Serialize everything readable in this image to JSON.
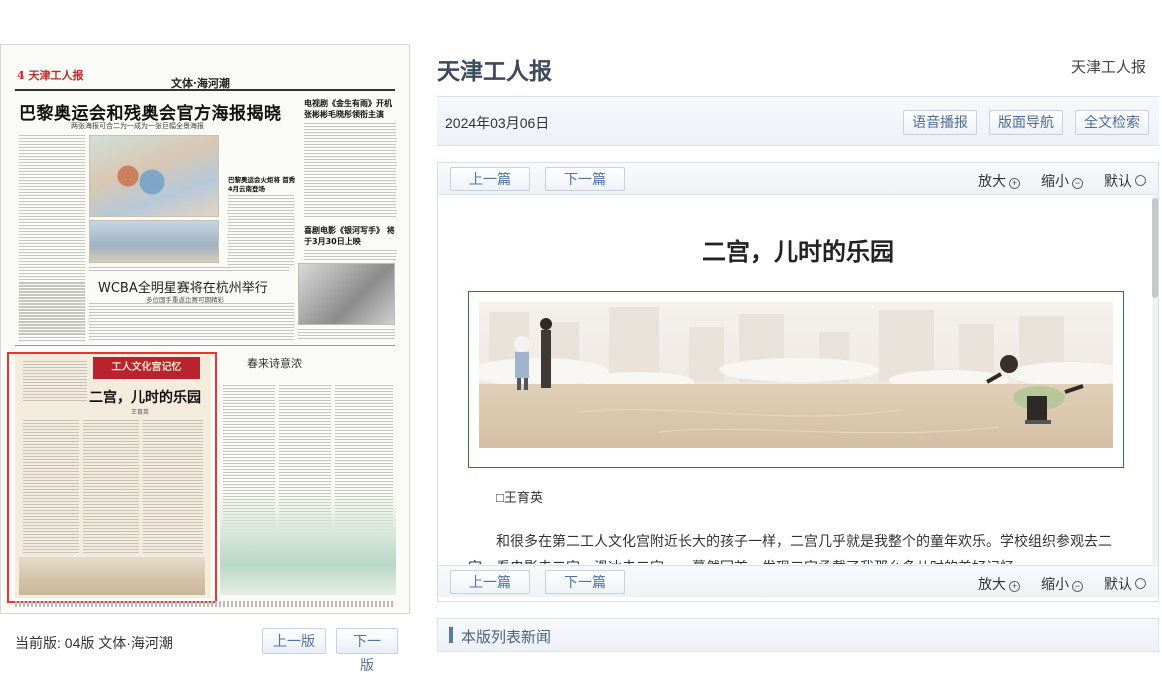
{
  "paper": {
    "masthead_number": "4 天津工人报",
    "section_name": "文体·海河潮",
    "headline": "巴黎奥运会和残奥会官方海报揭晓",
    "subhead": "两张海报可合二为一成为一张巨幅全景海报",
    "side_headline_1": "电视剧《金生有雨》开机 张彬彬毛晓彤领衔主演",
    "side_headline_2": "巴黎奥运会火炬将 首秀4月云南登场",
    "side_headline_3": "喜剧电影《银河写手》 将于3月30日上映",
    "wcba_headline": "WCBA全明星赛将在杭州举行",
    "wcba_subhead": "多位国手重返比赛可期精彩",
    "poster_banner": "工人文化宫记忆",
    "poster_title": "二宫，儿时的乐园",
    "poster_author": "王育英",
    "poem_title": "春来诗意浓"
  },
  "left_footer": {
    "current_edition": "当前版: 04版 文体·海河潮",
    "prev_page": "上一版",
    "next_page": "下一版"
  },
  "header": {
    "site_title": "天津工人报",
    "site_link": "天津工人报",
    "date": "2024年03月06日",
    "audio_button": "语音播报",
    "layout_nav_button": "版面导航",
    "search_button": "全文检索"
  },
  "toolbar": {
    "prev_article": "上一篇",
    "next_article": "下一篇",
    "zoom_in": "放大",
    "zoom_out": "缩小",
    "zoom_reset": "默认"
  },
  "article": {
    "title": "二宫，儿时的乐园",
    "author": "□王育英",
    "paragraph_1": "和很多在第二工人文化宫附近长大的孩子一样，二宫几乎就是我整个的童年欢乐。学校组织参观去二宫，看电影去二宫，滑冰去二宫……蓦然回首，发现二宫承载了我那么多儿时的美好记忆。"
  },
  "news_list": {
    "title": "本版列表新闻"
  },
  "colors": {
    "highlight_border": "#e8352f",
    "button_text": "#5174a4",
    "figure_border": "#2f7d2f",
    "title_dark": "#3b4a5d"
  }
}
